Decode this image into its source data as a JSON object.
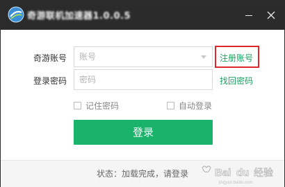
{
  "window": {
    "title": "奇游联机加速器1.0.0.5"
  },
  "form": {
    "account_label": "奇游账号",
    "account_placeholder": "账号",
    "password_label": "登录密码",
    "password_placeholder": "密码",
    "register_link": "注册账号",
    "forgot_link": "找回密码",
    "remember_label": "记住密码",
    "remember_checked": false,
    "auto_login_label": "自动登录",
    "auto_login_checked": false,
    "login_button": "登录"
  },
  "status": {
    "text": "状态：加载完成，请登录"
  },
  "watermark": {
    "text": "Baidu 经验"
  },
  "colors": {
    "titlebar": "#2b2b2b",
    "accent_green": "#19b36b",
    "link_green": "#1aa260",
    "highlight_red": "#e0262d"
  },
  "icons": {
    "logo": "qiyou-logo-icon",
    "minimize": "minimize-icon",
    "close": "close-icon",
    "dropdown": "chevron-down-icon"
  }
}
